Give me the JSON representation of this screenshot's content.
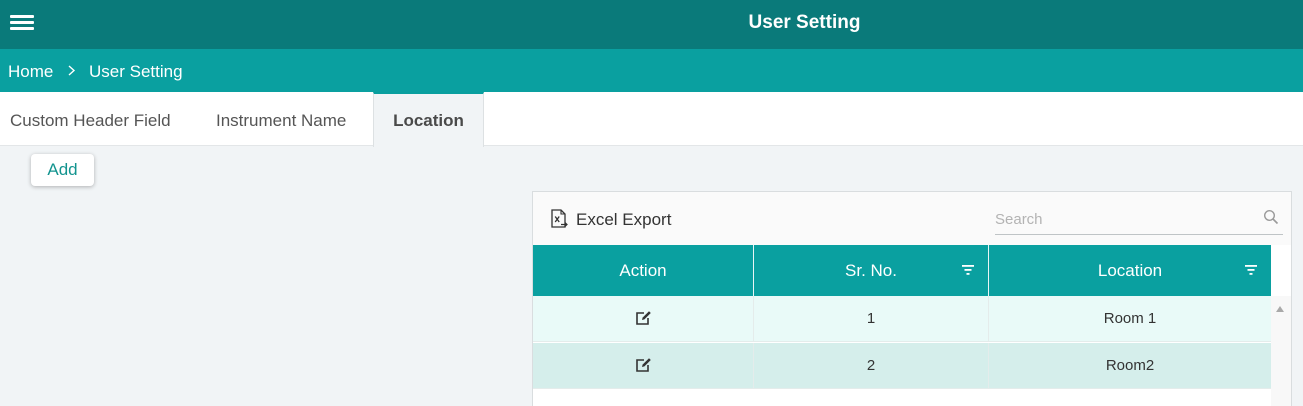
{
  "header": {
    "title": "User Setting",
    "menu_icon": "hamburger-menu-icon",
    "bg_color": "#0a7a7a"
  },
  "breadcrumb": {
    "home": "Home",
    "current": "User Setting",
    "separator_icon": "chevron-right-icon",
    "bg_color": "#0aa0a0"
  },
  "tabs": [
    {
      "label": "Custom Header Field",
      "active": false
    },
    {
      "label": "Instrument Name",
      "active": false
    },
    {
      "label": "Location",
      "active": true
    }
  ],
  "actions": {
    "add_label": "Add"
  },
  "grid": {
    "toolbar": {
      "export_label": "Excel Export",
      "export_icon": "excel-export-icon",
      "search_placeholder": "Search",
      "search_value": "",
      "search_icon": "search-icon"
    },
    "columns": [
      {
        "label": "Action",
        "filterable": false
      },
      {
        "label": "Sr. No.",
        "filterable": true
      },
      {
        "label": "Location",
        "filterable": true
      }
    ],
    "rows": [
      {
        "sr_no": "1",
        "location": "Room 1"
      },
      {
        "sr_no": "2",
        "location": "Room2"
      }
    ],
    "header_color": "#0aa0a0",
    "row_colors": [
      "#e9faf8",
      "#d5eeeb"
    ]
  }
}
